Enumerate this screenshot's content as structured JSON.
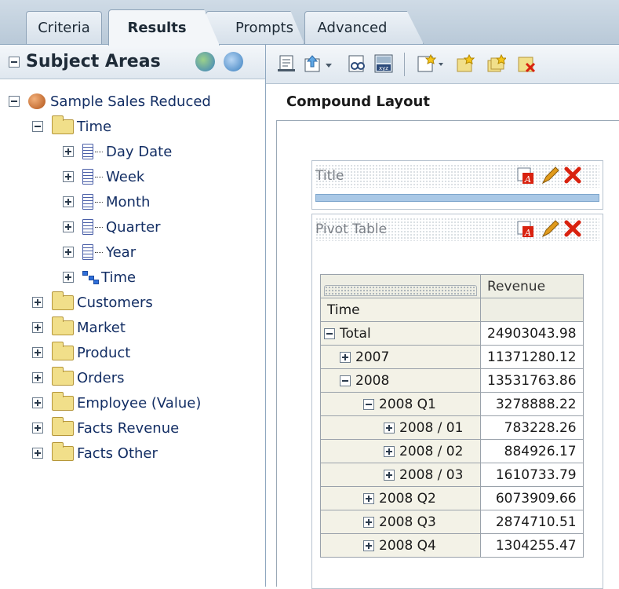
{
  "tabs": [
    {
      "label": "Criteria"
    },
    {
      "label": "Results"
    },
    {
      "label": "Prompts"
    },
    {
      "label": "Advanced"
    }
  ],
  "subject_areas": {
    "title": "Subject Areas",
    "root": "Sample Sales Reduced",
    "time_folder": "Time",
    "time_children": [
      "Day Date",
      "Week",
      "Month",
      "Quarter",
      "Year",
      "Time"
    ],
    "folders": [
      "Customers",
      "Market",
      "Product",
      "Orders",
      "Employee (Value)",
      "Facts Revenue",
      "Facts Other"
    ]
  },
  "layout": {
    "title": "Compound Layout",
    "views": [
      {
        "label": "Title"
      },
      {
        "label": "Pivot Table"
      }
    ]
  },
  "pivot": {
    "column_header": "Revenue",
    "row_header": "Time",
    "rows": [
      {
        "label": "Total",
        "value": "24903043.98"
      },
      {
        "label": "2007",
        "value": "11371280.12"
      },
      {
        "label": "2008",
        "value": "13531763.86"
      },
      {
        "label": "2008 Q1",
        "value": "3278888.22"
      },
      {
        "label": "2008 / 01",
        "value": "783228.26"
      },
      {
        "label": "2008 / 02",
        "value": "884926.17"
      },
      {
        "label": "2008 / 03",
        "value": "1610733.79"
      },
      {
        "label": "2008 Q2",
        "value": "6073909.66"
      },
      {
        "label": "2008 Q3",
        "value": "2874710.51"
      },
      {
        "label": "2008 Q4",
        "value": "1304255.47"
      }
    ]
  },
  "colors": {
    "link_text": "#132e64",
    "delete_red": "#d9220f",
    "pencil_orange": "#e09a1b"
  }
}
